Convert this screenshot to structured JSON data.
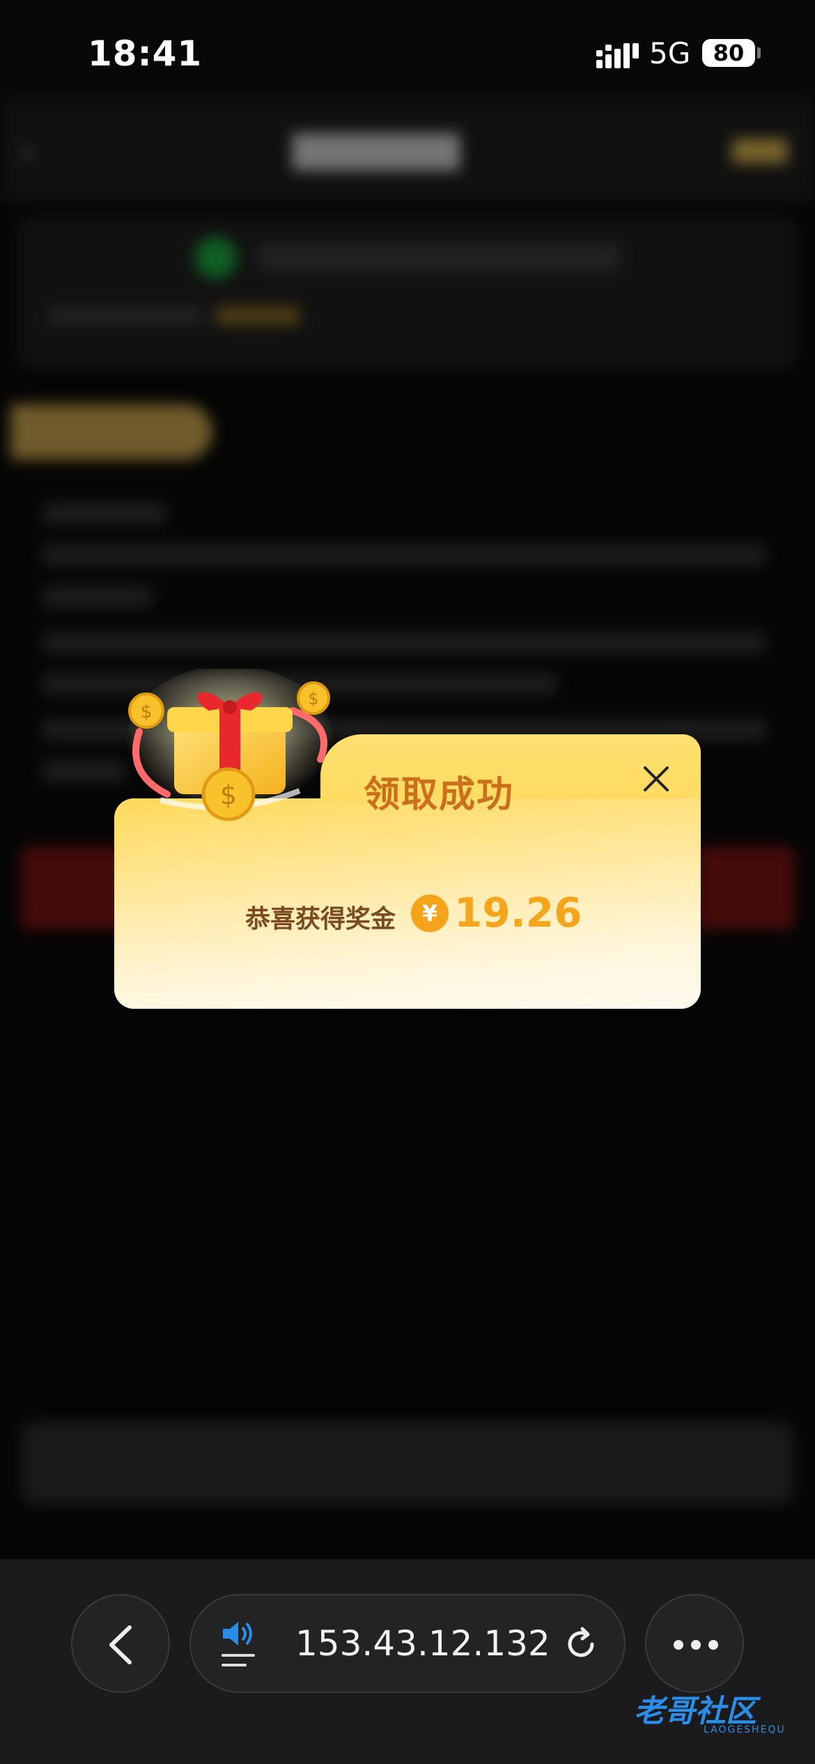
{
  "status_bar": {
    "time": "18:41",
    "network": "5G",
    "battery": "80"
  },
  "modal": {
    "title": "领取成功",
    "message": "恭喜获得奖金",
    "currency_symbol": "¥",
    "amount": "19.26",
    "accent_color": "#f5a51b"
  },
  "browser": {
    "url": "153.43.12.132",
    "back_icon": "chevron-left-icon",
    "audio_icon": "speaker-icon",
    "reload_icon": "reload-icon",
    "more_icon": "more-icon"
  },
  "watermark": {
    "text": "老哥社区",
    "sub": "LAOGESHEQU"
  }
}
